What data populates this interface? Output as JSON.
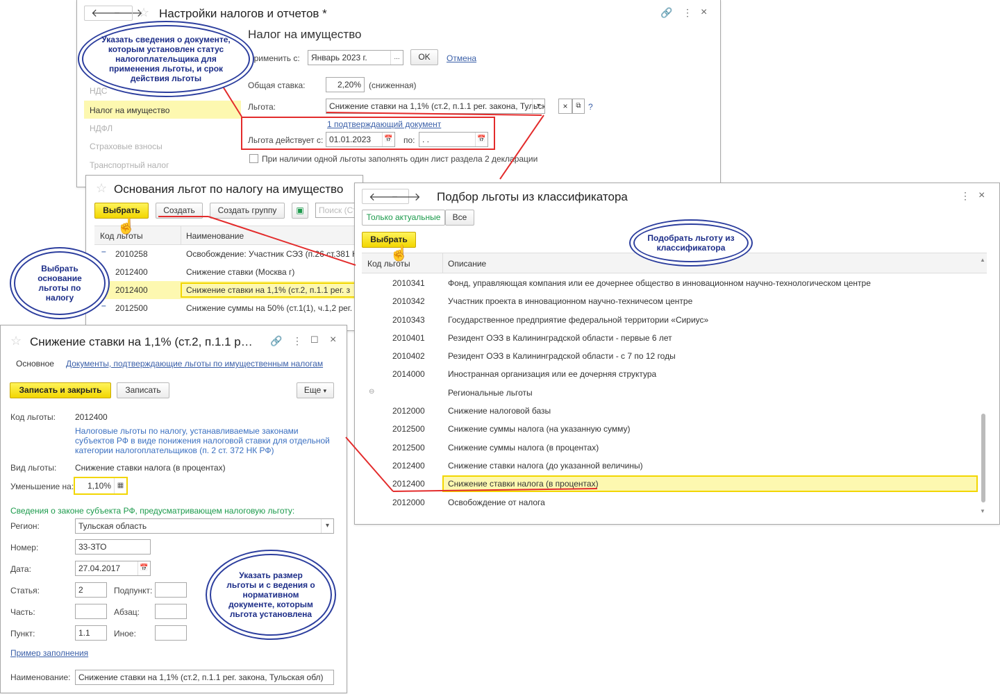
{
  "w1": {
    "title": "Настройки налогов и отчетов *",
    "section_title": "Налог на имущество",
    "side_items": [
      "НДС",
      "Налог на имущество",
      "НДФЛ",
      "Страховые взносы",
      "Транспортный налог"
    ],
    "apply_label": "Применить с:",
    "apply_value": "Январь 2023 г.",
    "ok": "OK",
    "cancel": "Отмена",
    "rate_label": "Общая ставка:",
    "rate_value": "2,20%",
    "rate_note": "(сниженная)",
    "benefit_label": "Льгота:",
    "benefit_value": "Снижение ставки на 1,1% (ст.2, п.1.1 рег. закона, Тульск",
    "docs_link": "1 подтверждающий документ",
    "valid_label": "Льгота действует с:",
    "valid_from": "01.01.2023",
    "to_label": "по:",
    "to_value": " .  .",
    "checkbox_text": "При наличии одной льготы заполнять один лист раздела 2 декларации",
    "help": "?"
  },
  "w2": {
    "title": "Основания льгот по налогу на имущество",
    "select": "Выбрать",
    "create": "Создать",
    "create_group": "Создать группу",
    "search_placeholder": "Поиск (Ст",
    "col_code": "Код льготы",
    "col_name": "Наименование",
    "rows": [
      {
        "code": "2010258",
        "name": "Освобождение: Участник СЭЗ (п.26 ст.381 Н"
      },
      {
        "code": "2012400",
        "name": "Снижение ставки (Москва г)"
      },
      {
        "code": "2012400",
        "name": "Снижение ставки на 1,1% (ст.2, п.1.1 рег. з"
      },
      {
        "code": "2012500",
        "name": "Снижение суммы на 50% (ст.1(1), ч.1,2 рег."
      }
    ]
  },
  "w3": {
    "title": "Подбор льготы из классификатора",
    "tab_actual": "Только актуальные",
    "tab_all": "Все",
    "select": "Выбрать",
    "col_code": "Код льготы",
    "col_desc": "Описание",
    "rows": [
      {
        "code": "2010341",
        "desc": "Фонд, управляющая компания или ее дочернее общество в инновационном научно-технологическом центре"
      },
      {
        "code": "2010342",
        "desc": "Участник проекта в инновационном научно-техничесом центре"
      },
      {
        "code": "2010343",
        "desc": "Государственное предприятие федеральной территории «Сириус»"
      },
      {
        "code": "2010401",
        "desc": "Резидент ОЭЗ в Калининградской области - первые 6 лет"
      },
      {
        "code": "2010402",
        "desc": "Резидент ОЭЗ в Калининградской области - с 7 по 12 годы"
      },
      {
        "code": "2014000",
        "desc": "Иностранная организация или ее дочерняя структура"
      },
      {
        "code": "",
        "desc": "Региональные льготы"
      },
      {
        "code": "2012000",
        "desc": "Снижение налоговой базы"
      },
      {
        "code": "2012500",
        "desc": "Снижение суммы налога (на указанную сумму)"
      },
      {
        "code": "2012500",
        "desc": "Снижение суммы налога (в процентах)"
      },
      {
        "code": "2012400",
        "desc": "Снижение ставки налога (до указанной величины)"
      },
      {
        "code": "2012400",
        "desc": "Снижение ставки налога (в процентах)"
      },
      {
        "code": "2012000",
        "desc": "Освобождение от налога"
      }
    ]
  },
  "w4": {
    "title": "Снижение ставки на 1,1% (ст.2, п.1.1 р…",
    "tab_main": "Основное",
    "tab_docs": "Документы, подтверждающие льготы по имущественным налогам",
    "save_close": "Записать и закрыть",
    "save": "Записать",
    "more": "Еще",
    "code_label": "Код льготы:",
    "code_value": "2012400",
    "code_desc": [
      "Налоговые льготы по налогу, устанавливаемые законами",
      "субъектов РФ в виде понижения налоговой ставки для отдельной",
      "категории налогоплательщиков (п. 2 ст. 372 НК РФ)"
    ],
    "kind_label": "Вид льготы:",
    "kind_value": "Снижение ставки налога (в процентах)",
    "reduce_label": "Уменьшение на:",
    "reduce_value": "1,10%",
    "law_header": "Сведения о законе субъекта РФ, предусматривающем налоговую льготу:",
    "region_label": "Регион:",
    "region_value": "Тульская область",
    "number_label": "Номер:",
    "number_value": "33-ЗТО",
    "date_label": "Дата:",
    "date_value": "27.04.2017",
    "article_label": "Статья:",
    "article_value": "2",
    "subpoint_label": "Подпункт:",
    "part_label": "Часть:",
    "paragraph_label": "Абзац:",
    "point_label": "Пункт:",
    "point_value": "1.1",
    "other_label": "Иное:",
    "example_link": "Пример заполнения",
    "name_label": "Наименование:",
    "name_value": "Снижение ставки на 1,1% (ст.2, п.1.1 рег. закона, Тульская обл)"
  },
  "callouts": {
    "c1": "Указать сведения о документе, которым установлен статус налогоплательщика для применения льготы, и срок действия льготы",
    "c2": "Выбрать основание льготы по налогу",
    "c3": "Подобрать льготу из классификатора",
    "c4": "Указать размер льготы и с ведения о нормативном документе, которым льгота установлена"
  },
  "colors": {
    "accent_red": "#e32b2b",
    "highlight": "#fdf8b0",
    "callout_border": "#2c3e9e",
    "green": "#1b9a4b"
  }
}
